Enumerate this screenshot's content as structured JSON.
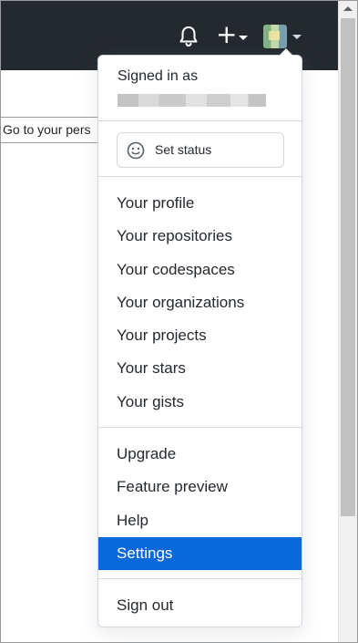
{
  "header": {
    "icons": [
      "bell-icon",
      "plus-icon",
      "avatar",
      "chevron-down-icon"
    ]
  },
  "tooltip": {
    "text": "Go to your pers"
  },
  "dropdown": {
    "signed_in_label": "Signed in as",
    "set_status_label": "Set status",
    "group1": [
      "Your profile",
      "Your repositories",
      "Your codespaces",
      "Your organizations",
      "Your projects",
      "Your stars",
      "Your gists"
    ],
    "group2": [
      "Upgrade",
      "Feature preview",
      "Help",
      "Settings"
    ],
    "sign_out_label": "Sign out",
    "selected_item": "Settings"
  },
  "colors": {
    "header_bg": "#24292f",
    "selected_bg": "#0969da",
    "border": "#d0d7de"
  }
}
